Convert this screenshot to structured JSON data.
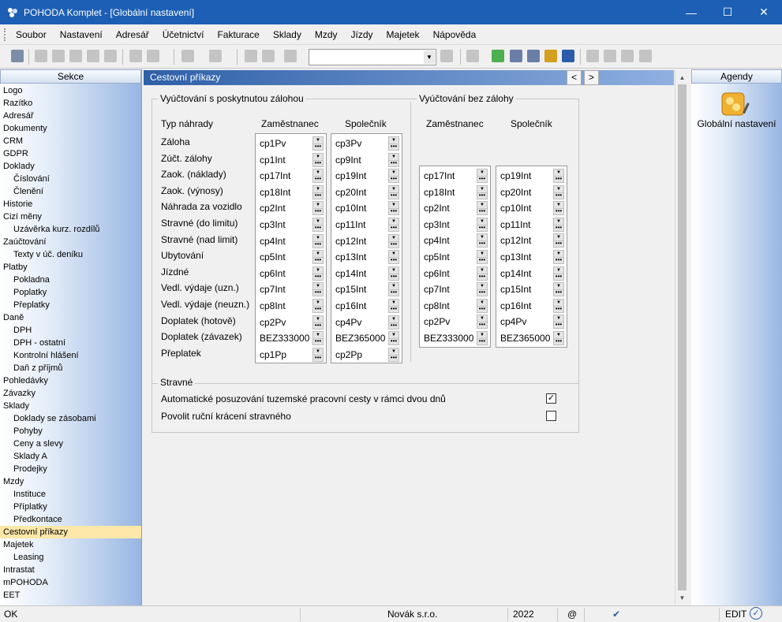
{
  "window": {
    "title": "POHODA Komplet - [Globální nastavení]",
    "min": "—",
    "max": "☐",
    "close": "✕"
  },
  "menu": [
    "Soubor",
    "Nastavení",
    "Adresář",
    "Účetnictví",
    "Fakturace",
    "Sklady",
    "Mzdy",
    "Jízdy",
    "Majetek",
    "Nápověda"
  ],
  "sekce": {
    "header": "Sekce",
    "items": [
      {
        "label": "Logo",
        "sub": false
      },
      {
        "label": "Razítko",
        "sub": false
      },
      {
        "label": "Adresář",
        "sub": false
      },
      {
        "label": "Dokumenty",
        "sub": false
      },
      {
        "label": "CRM",
        "sub": false
      },
      {
        "label": "GDPR",
        "sub": false
      },
      {
        "label": "Doklady",
        "sub": false
      },
      {
        "label": "Číslování",
        "sub": true
      },
      {
        "label": "Členění",
        "sub": true
      },
      {
        "label": "Historie",
        "sub": false
      },
      {
        "label": "Cizí měny",
        "sub": false
      },
      {
        "label": "Uzávěrka kurz. rozdílů",
        "sub": true
      },
      {
        "label": "Zaúčtování",
        "sub": false
      },
      {
        "label": "Texty v úč. deníku",
        "sub": true
      },
      {
        "label": "Platby",
        "sub": false
      },
      {
        "label": "Pokladna",
        "sub": true
      },
      {
        "label": "Poplatky",
        "sub": true
      },
      {
        "label": "Přeplatky",
        "sub": true
      },
      {
        "label": "Daně",
        "sub": false
      },
      {
        "label": "DPH",
        "sub": true
      },
      {
        "label": "DPH - ostatní",
        "sub": true
      },
      {
        "label": "Kontrolní hlášení",
        "sub": true
      },
      {
        "label": "Daň z příjmů",
        "sub": true
      },
      {
        "label": "Pohledávky",
        "sub": false
      },
      {
        "label": "Závazky",
        "sub": false
      },
      {
        "label": "Sklady",
        "sub": false
      },
      {
        "label": "Doklady se zásobami",
        "sub": true
      },
      {
        "label": "Pohyby",
        "sub": true
      },
      {
        "label": "Ceny a slevy",
        "sub": true
      },
      {
        "label": "Sklady A",
        "sub": true
      },
      {
        "label": "Prodejky",
        "sub": true
      },
      {
        "label": "Mzdy",
        "sub": false
      },
      {
        "label": "Instituce",
        "sub": true
      },
      {
        "label": "Příplatky",
        "sub": true
      },
      {
        "label": "Předkontace",
        "sub": true
      },
      {
        "label": "Cestovní příkazy",
        "sub": false,
        "selected": true
      },
      {
        "label": "Majetek",
        "sub": false
      },
      {
        "label": "Leasing",
        "sub": true
      },
      {
        "label": "Intrastat",
        "sub": false
      },
      {
        "label": "mPOHODA",
        "sub": false
      },
      {
        "label": "EET",
        "sub": false
      }
    ]
  },
  "content": {
    "title": "Cestovní příkazy",
    "nav_prev": "<",
    "nav_next": ">",
    "group1": {
      "title": "Vyúčtování s poskytnutou zálohou",
      "col_type": "Typ náhrady",
      "col_emp": "Zaměstnanec",
      "col_comp": "Společník"
    },
    "group2": {
      "title": "Vyúčtování bez zálohy",
      "col_emp": "Zaměstnanec",
      "col_comp": "Společník"
    },
    "types": [
      "Záloha",
      "Zúčt. zálohy",
      "Zaok. (náklady)",
      "Zaok. (výnosy)",
      "Náhrada za vozidlo",
      "Stravné (do limitu)",
      "Stravné (nad limit)",
      "Ubytování",
      "Jízdné",
      "Vedl. výdaje (uzn.)",
      "Vedl. výdaje (neuzn.)",
      "Doplatek (hotově)",
      "Doplatek (závazek)",
      "Přeplatek"
    ],
    "with_advance_emp": [
      "cp1Pv",
      "cp1Int",
      "cp17Int",
      "cp18Int",
      "cp2Int",
      "cp3Int",
      "cp4Int",
      "cp5Int",
      "cp6Int",
      "cp7Int",
      "cp8Int",
      "cp2Pv",
      "BEZ333000",
      "cp1Pp"
    ],
    "with_advance_comp": [
      "cp3Pv",
      "cp9Int",
      "cp19Int",
      "cp20Int",
      "cp10Int",
      "cp11Int",
      "cp12Int",
      "cp13Int",
      "cp14Int",
      "cp15Int",
      "cp16Int",
      "cp4Pv",
      "BEZ365000",
      "cp2Pp"
    ],
    "no_advance_emp": [
      "cp17Int",
      "cp18Int",
      "cp2Int",
      "cp3Int",
      "cp4Int",
      "cp5Int",
      "cp6Int",
      "cp7Int",
      "cp8Int",
      "cp2Pv",
      "BEZ333000"
    ],
    "no_advance_comp": [
      "cp19Int",
      "cp20Int",
      "cp10Int",
      "cp11Int",
      "cp12Int",
      "cp13Int",
      "cp14Int",
      "cp15Int",
      "cp16Int",
      "cp4Pv",
      "BEZ365000"
    ],
    "stravne": {
      "title": "Stravné",
      "opt1": "Automatické posuzování tuzemské pracovní cesty v rámci dvou dnů",
      "opt1_checked": true,
      "opt2": "Povolit ruční krácení stravného",
      "opt2_checked": false
    }
  },
  "agendy": {
    "header": "Agendy",
    "item": "Globální nastavení"
  },
  "status": {
    "left": "OK",
    "company": "Novák s.r.o.",
    "year": "2022",
    "at": "@",
    "mode": "EDIT"
  },
  "colors": {
    "title_bar": "#1c5fb4",
    "section_header": "#2e5fa8",
    "selected_item": "#fde7a9"
  }
}
